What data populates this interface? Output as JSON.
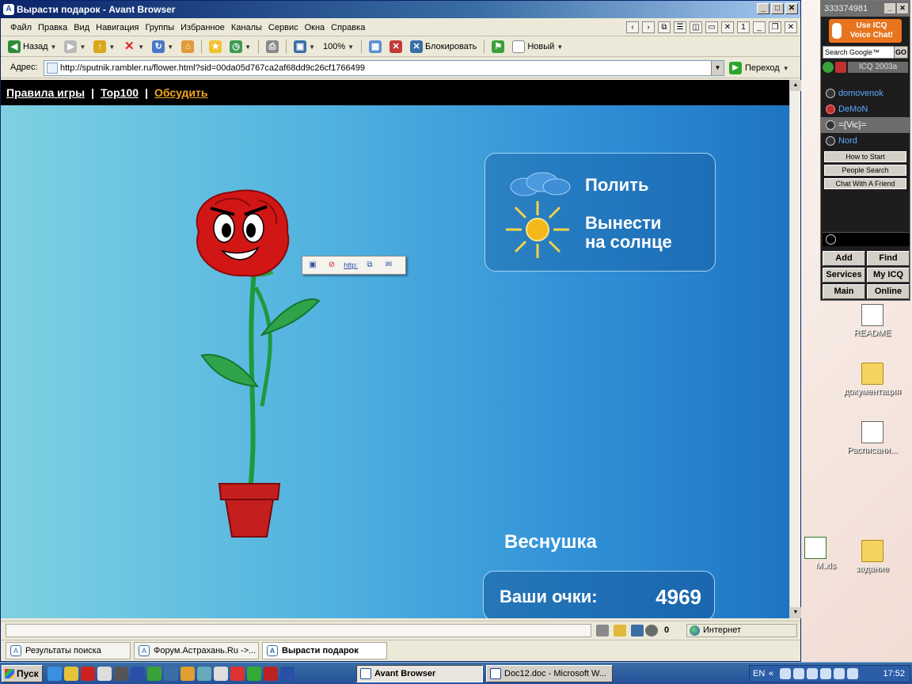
{
  "window": {
    "title": "Вырасти подарок - Avant Browser"
  },
  "menu": [
    "Файл",
    "Правка",
    "Вид",
    "Навигация",
    "Группы",
    "Избранное",
    "Каналы",
    "Сервис",
    "Окна",
    "Справка"
  ],
  "menu_right_count": "1",
  "toolbar": {
    "back_label": "Назад",
    "zoom": "100%",
    "block_label": "Блокировать",
    "new_label": "Новый"
  },
  "address": {
    "label": "Адрес:",
    "url": "http://sputnik.rambler.ru/flower.html?sid=00da05d767ca2af68dd9c26cf1766499",
    "go_label": "Переход"
  },
  "page": {
    "nav": {
      "rules": "Правила игры",
      "top100": "Top100",
      "discuss": "Обсудить",
      "separator": "|"
    },
    "actions": {
      "water": "Полить",
      "sun_line1": "Вынести",
      "sun_line2": "на солнце"
    },
    "flower_name": "Веснушка",
    "score": {
      "label": "Ваши очки:",
      "value": "4969"
    },
    "mini_toolbar": {
      "http_label": "http:"
    }
  },
  "status": {
    "count": "0",
    "zone": "Интернет"
  },
  "tabs": [
    {
      "label": "Результаты поиска",
      "active": false
    },
    {
      "label": "Форум.Астрахань.Ru ->...",
      "active": false
    },
    {
      "label": "Вырасти подарок",
      "active": true
    }
  ],
  "icq": {
    "uin": "333374981",
    "voice_line1": "Use ICQ",
    "voice_line2": "Voice Chat!",
    "search_label": "Search Google™",
    "search_go": "GO",
    "version": "ICQ 2003a",
    "contacts": [
      {
        "name": "domovenok",
        "selected": false
      },
      {
        "name": "DeMoN",
        "selected": false
      },
      {
        "name": "={Vic}=",
        "selected": true
      },
      {
        "name": "Nord",
        "selected": false
      }
    ],
    "links": [
      "How to Start",
      "People Search",
      "Chat With A Friend"
    ],
    "buttons": [
      "Add",
      "Find",
      "Services",
      "My ICQ",
      "Main",
      "Online"
    ]
  },
  "desktop_icons": [
    {
      "label": "README"
    },
    {
      "label": "документация"
    },
    {
      "label": "Расписани..."
    },
    {
      "label": "M.xls"
    },
    {
      "label": "задание"
    }
  ],
  "taskbar": {
    "start": "Пуск",
    "tasks": [
      {
        "label": "Avant Browser",
        "active": true
      },
      {
        "label": "Doc12.doc - Microsoft W...",
        "active": false
      }
    ],
    "lang": "EN",
    "tray_chevron": "«",
    "clock": "17:52"
  },
  "colors": {
    "stage_left": "#7fd1e1",
    "stage_right": "#1f74c2",
    "nav_link_highlight": "#f5a623",
    "icq_contact": "#5ea8ff"
  }
}
